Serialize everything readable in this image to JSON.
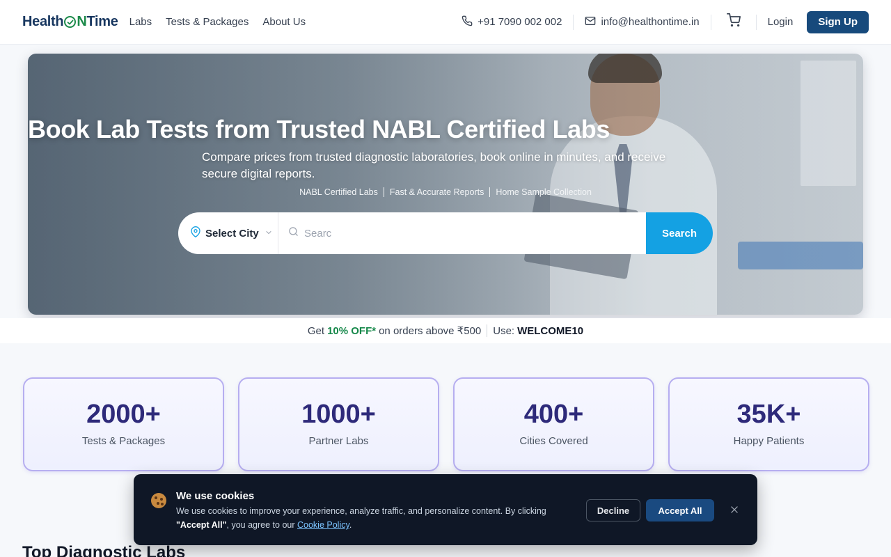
{
  "header": {
    "logo_part1": "Health",
    "logo_part2": "N",
    "logo_part3": "Time",
    "nav": [
      "Labs",
      "Tests & Packages",
      "About Us"
    ],
    "phone": "+91 7090 002 002",
    "email": "info@healthontime.in",
    "login_label": "Login",
    "signup_label": "Sign Up"
  },
  "hero": {
    "title": "Book Lab Tests from Trusted NABL Certified Labs",
    "subtitle": "Compare prices from trusted diagnostic laboratories, book online in minutes, and receive secure digital reports.",
    "features": [
      "NABL Certified Labs",
      "Fast & Accurate Reports",
      "Home Sample Collection"
    ],
    "city_label": "Select City",
    "search_value": "Searc",
    "search_button": "Search"
  },
  "offer": {
    "prefix": "Get",
    "discount": "10% OFF*",
    "middle": "on orders above ₹500",
    "use_label": "Use:",
    "code": "WELCOME10"
  },
  "stats": [
    {
      "value": "2000+",
      "label": "Tests & Packages"
    },
    {
      "value": "1000+",
      "label": "Partner Labs"
    },
    {
      "value": "400+",
      "label": "Cities Covered"
    },
    {
      "value": "35K+",
      "label": "Happy Patients"
    }
  ],
  "section_title": "Top Diagnostic Labs",
  "cookie": {
    "title": "We use cookies",
    "text_before": "We use cookies to improve your experience, analyze traffic, and personalize content. By clicking",
    "bold": "\"Accept All\"",
    "text_after": ", you agree to our",
    "link": "Cookie Policy",
    "period": ".",
    "decline_label": "Decline",
    "accept_label": "Accept All"
  },
  "colors": {
    "brand_navy": "#174a7c",
    "brand_green": "#1c8a4a",
    "search_blue": "#14a1e3",
    "stat_number": "#2e2a7a",
    "cookie_bg": "#0f1726"
  },
  "icons": [
    "phone-icon",
    "mail-icon",
    "cart-icon",
    "location-pin-icon",
    "chevron-down-icon",
    "search-icon",
    "cookie-icon",
    "close-icon",
    "check-icon"
  ]
}
